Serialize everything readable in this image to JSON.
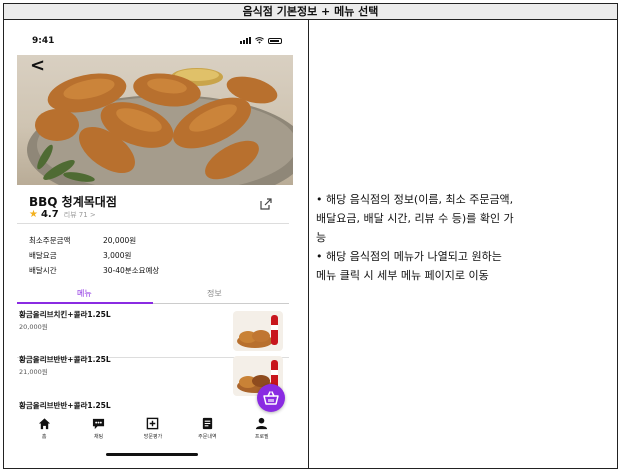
{
  "header": {
    "title": "음식점 기본정보 + 메뉴 선택"
  },
  "phone": {
    "status_time": "9:41",
    "store": {
      "name": "BBQ 청계목대점",
      "rating": "4.7",
      "reviews_label": "리뷰 71 >"
    },
    "info": [
      {
        "label": "최소주문금액",
        "value": "20,000원"
      },
      {
        "label": "배달요금",
        "value": "3,000원"
      },
      {
        "label": "배달시간",
        "value": "30-40분소요예상"
      }
    ],
    "tabs": {
      "menu": "메뉴",
      "info": "정보"
    },
    "menu_items": [
      {
        "name": "황금올리브치킨+콜라1.25L",
        "price": "20,000원"
      },
      {
        "name": "황금올리브반반+콜라1.25L",
        "price": "21,000원"
      },
      {
        "name": "황금올리브반반+콜라1.25L",
        "price": ""
      }
    ],
    "nav": [
      {
        "label": "홈",
        "icon": "home-icon"
      },
      {
        "label": "채팅",
        "icon": "chat-icon"
      },
      {
        "label": "방문평가",
        "icon": "plus-square-icon"
      },
      {
        "label": "주문내역",
        "icon": "receipt-icon"
      },
      {
        "label": "프로필",
        "icon": "profile-icon"
      }
    ],
    "accent_color": "#8a2be2"
  },
  "description": {
    "lines": [
      "• 해당 음식점의 정보(이름, 최소 주문금액,",
      "배달요금, 배달 시간, 리뷰 수 등)를 확인 가",
      "능",
      "• 해당 음식점의 메뉴가 나열되고 원하는",
      "메뉴 클릭 시 세부 메뉴 페이지로 이동"
    ]
  }
}
